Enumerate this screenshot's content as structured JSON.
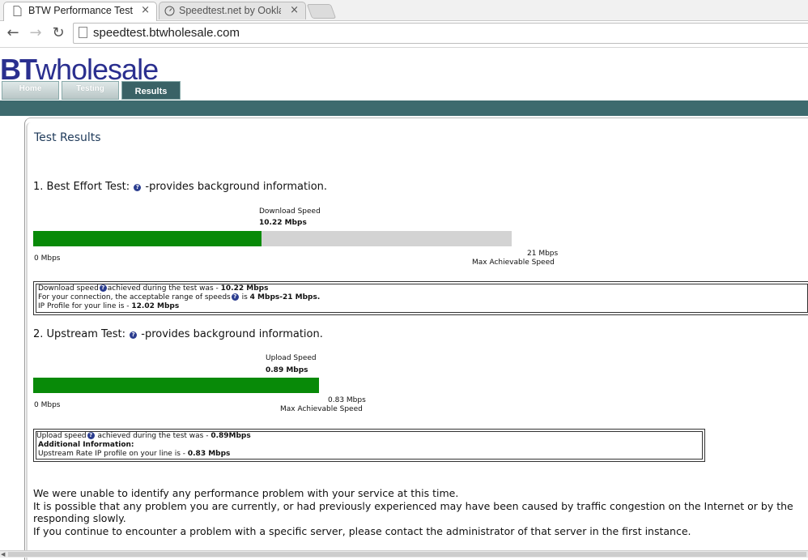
{
  "browser": {
    "tabs": [
      {
        "title": "BTW Performance Test",
        "active": true
      },
      {
        "title": "Speedtest.net by Ookla - ",
        "active": false
      }
    ],
    "close_glyph": "×",
    "url": "speedtest.btwholesale.com"
  },
  "site": {
    "logo_bt": "BT",
    "logo_rest": "wholesale",
    "nav": {
      "home": "Home",
      "testing": "Testing",
      "results": "Results"
    },
    "brand_color": "#2a2f8f",
    "band_color": "#3d6a6e"
  },
  "page_title": "Test Results",
  "best_effort": {
    "heading_prefix": "1. Best Effort Test:",
    "heading_suffix": "-provides background information.",
    "gauge_label": "Download  Speed",
    "gauge_value": "10.22 Mbps",
    "min_label": "0 Mbps",
    "max_value": "21 Mbps",
    "max_label": "Max Achievable Speed",
    "fill_fraction": 0.478,
    "info": {
      "line1_pre": "Download speed",
      "line1_mid": "achieved during the test was - ",
      "line1_val": "10.22 Mbps",
      "line2_pre": "For your connection, the acceptable range of speeds",
      "line2_mid": " is ",
      "line2_val": "4 Mbps-21 Mbps.",
      "line3_pre": "IP Profile for your line is - ",
      "line3_val": "12.02 Mbps"
    }
  },
  "upstream": {
    "heading_prefix": "2. Upstream Test:",
    "heading_suffix": "-provides background information.",
    "gauge_label": "Upload Speed",
    "gauge_value": "0.89 Mbps",
    "min_label": "0 Mbps",
    "max_value": "0.83 Mbps",
    "max_label": "Max Achievable Speed",
    "fill_fraction": 1.0,
    "info": {
      "line1_pre": "Upload speed",
      "line1_mid": " achieved during the test was - ",
      "line1_val": "0.89Mbps",
      "line2": "Additional Information:",
      "line3_pre": "Upstream Rate IP profile on your line is - ",
      "line3_val": "0.83 Mbps"
    }
  },
  "message": [
    "We were unable to identify any performance problem with your service at this time.",
    "It is possible that any problem you are currently, or had previously experienced may have been caused by traffic congestion on the Internet or by the",
    "responding slowly.",
    "If you continue to encounter a problem with a specific server, please contact the administrator of that server in the first instance."
  ]
}
